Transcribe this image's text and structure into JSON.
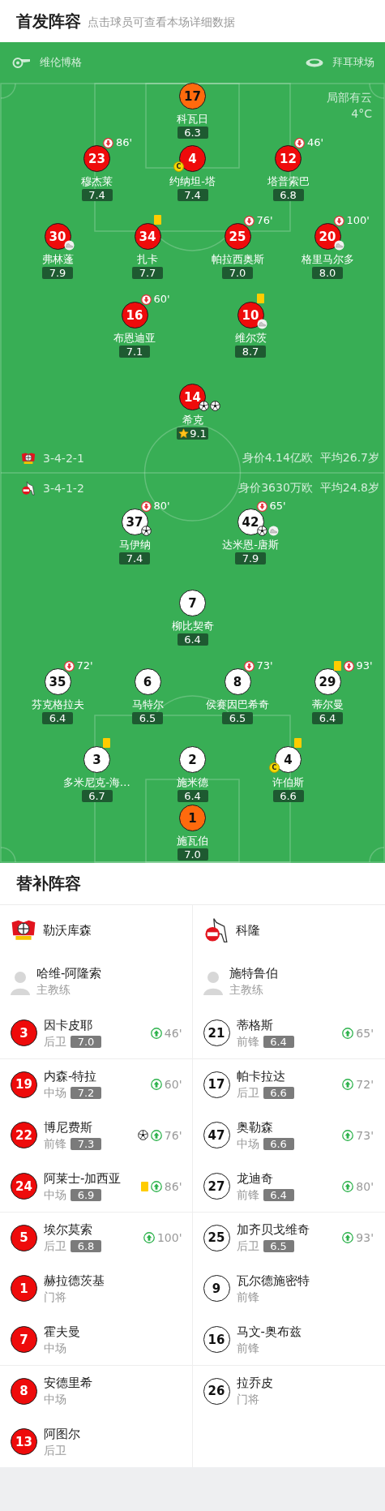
{
  "header": {
    "title": "首发阵容",
    "subtitle": "点击球员可查看本场详细数据"
  },
  "match_info": {
    "referee": "维伦博格",
    "stadium": "拜耳球场",
    "weather": "局部有云",
    "temperature": "4°C"
  },
  "lineups": [
    {
      "kind": "home",
      "formation": "3-4-2-1",
      "value": "身价4.14亿欧",
      "avg_age": "平均26.7岁",
      "rows": [
        [
          {
            "number": "17",
            "name": "科瓦日",
            "rating": "6.3",
            "goalkeeper": true,
            "best": false
          }
        ],
        [
          {
            "number": "23",
            "name": "穆杰莱",
            "rating": "7.4",
            "goalkeeper": false,
            "best": false,
            "events": [
              {
                "kind": "sub_out",
                "minute": "86'"
              }
            ]
          },
          {
            "number": "4",
            "name": "约纳坦-塔",
            "rating": "7.4",
            "goalkeeper": false,
            "best": false,
            "events": [
              {
                "kind": "captain",
                "label": "C"
              }
            ]
          },
          {
            "number": "12",
            "name": "塔普索巴",
            "rating": "6.8",
            "goalkeeper": false,
            "best": false,
            "events": [
              {
                "kind": "sub_out",
                "minute": "46'"
              }
            ]
          }
        ],
        [
          {
            "number": "30",
            "name": "弗林蓬",
            "rating": "7.9",
            "goalkeeper": false,
            "best": false,
            "events": [
              {
                "kind": "assist"
              }
            ]
          },
          {
            "number": "34",
            "name": "扎卡",
            "rating": "7.7",
            "goalkeeper": false,
            "best": false,
            "events": [
              {
                "kind": "yellow_card"
              }
            ]
          },
          {
            "number": "25",
            "name": "帕拉西奥斯",
            "rating": "7.0",
            "goalkeeper": false,
            "best": false,
            "events": [
              {
                "kind": "sub_out",
                "minute": "76'"
              }
            ]
          },
          {
            "number": "20",
            "name": "格里马尔多",
            "rating": "8.0",
            "goalkeeper": false,
            "best": false,
            "events": [
              {
                "kind": "sub_out",
                "minute": "100'"
              },
              {
                "kind": "assist"
              }
            ]
          }
        ],
        [
          {
            "number": "16",
            "name": "布恩迪亚",
            "rating": "7.1",
            "goalkeeper": false,
            "best": false,
            "events": [
              {
                "kind": "sub_out",
                "minute": "60'"
              }
            ]
          },
          {
            "number": "10",
            "name": "维尔茨",
            "rating": "8.7",
            "goalkeeper": false,
            "best": false,
            "events": [
              {
                "kind": "yellow_card"
              },
              {
                "kind": "assist"
              }
            ]
          }
        ],
        [
          {
            "number": "14",
            "name": "希克",
            "rating": "9.1",
            "goalkeeper": false,
            "best": true,
            "events": [
              {
                "kind": "goal"
              },
              {
                "kind": "goal"
              }
            ]
          }
        ]
      ]
    },
    {
      "kind": "away",
      "formation": "3-4-1-2",
      "value": "身价3630万欧",
      "avg_age": "平均24.8岁",
      "rows": [
        [
          {
            "number": "37",
            "name": "马伊纳",
            "rating": "7.4",
            "goalkeeper": false,
            "best": false,
            "events": [
              {
                "kind": "sub_out",
                "minute": "80'"
              },
              {
                "kind": "goal"
              }
            ]
          },
          {
            "number": "42",
            "name": "达米恩-唐斯",
            "rating": "7.9",
            "goalkeeper": false,
            "best": false,
            "events": [
              {
                "kind": "sub_out",
                "minute": "65'"
              },
              {
                "kind": "goal"
              },
              {
                "kind": "assist"
              }
            ]
          }
        ],
        [
          {
            "number": "7",
            "name": "柳比契奇",
            "rating": "6.4",
            "goalkeeper": false,
            "best": false
          }
        ],
        [
          {
            "number": "35",
            "name": "芬克格拉夫",
            "rating": "6.4",
            "goalkeeper": false,
            "best": false,
            "events": [
              {
                "kind": "sub_out",
                "minute": "72'"
              }
            ]
          },
          {
            "number": "6",
            "name": "马特尔",
            "rating": "6.5",
            "goalkeeper": false,
            "best": false
          },
          {
            "number": "8",
            "name": "侯赛因巴希奇",
            "rating": "6.5",
            "goalkeeper": false,
            "best": false,
            "events": [
              {
                "kind": "sub_out",
                "minute": "73'"
              }
            ]
          },
          {
            "number": "29",
            "name": "蒂尔曼",
            "rating": "6.4",
            "goalkeeper": false,
            "best": false,
            "events": [
              {
                "kind": "yellow_card"
              },
              {
                "kind": "sub_out",
                "minute": "93'"
              }
            ]
          }
        ],
        [
          {
            "number": "3",
            "name": "多米尼克-海…",
            "rating": "6.7",
            "goalkeeper": false,
            "best": false,
            "events": [
              {
                "kind": "yellow_card"
              }
            ]
          },
          {
            "number": "2",
            "name": "施米德",
            "rating": "6.4",
            "goalkeeper": false,
            "best": false
          },
          {
            "number": "4",
            "name": "许伯斯",
            "rating": "6.6",
            "goalkeeper": false,
            "best": false,
            "events": [
              {
                "kind": "yellow_card"
              },
              {
                "kind": "captain",
                "label": "C"
              }
            ]
          }
        ],
        [
          {
            "number": "1",
            "name": "施瓦伯",
            "rating": "7.0",
            "goalkeeper": true,
            "best": false
          }
        ]
      ]
    }
  ],
  "subs": {
    "title": "替补阵容",
    "teams": [
      {
        "kind": "home",
        "name": "勒沃库森",
        "coach": {
          "name": "哈维-阿隆索",
          "role": "主教练"
        },
        "players": [
          {
            "number": "3",
            "name": "因卡皮耶",
            "position": "后卫",
            "rating": "7.0",
            "events": [
              {
                "kind": "sub_in",
                "minute": "46'"
              }
            ]
          },
          {
            "number": "19",
            "name": "内森-特拉",
            "position": "中场",
            "rating": "7.2",
            "events": [
              {
                "kind": "sub_in",
                "minute": "60'"
              }
            ]
          },
          {
            "number": "22",
            "name": "博尼费斯",
            "position": "前锋",
            "rating": "7.3",
            "events": [
              {
                "kind": "goal"
              },
              {
                "kind": "sub_in",
                "minute": "76'"
              }
            ]
          },
          {
            "number": "24",
            "name": "阿莱士-加西亚",
            "position": "中场",
            "rating": "6.9",
            "events": [
              {
                "kind": "yellow_card"
              },
              {
                "kind": "sub_in",
                "minute": "86'"
              }
            ]
          },
          {
            "number": "5",
            "name": "埃尔莫索",
            "position": "后卫",
            "rating": "6.8",
            "events": [
              {
                "kind": "sub_in",
                "minute": "100'"
              }
            ]
          },
          {
            "number": "1",
            "name": "赫拉德茨基",
            "position": "门将"
          },
          {
            "number": "7",
            "name": "霍夫曼",
            "position": "中场"
          },
          {
            "number": "8",
            "name": "安德里希",
            "position": "中场"
          },
          {
            "number": "13",
            "name": "阿图尔",
            "position": "后卫"
          }
        ]
      },
      {
        "kind": "away",
        "name": "科隆",
        "coach": {
          "name": "施特鲁伯",
          "role": "主教练"
        },
        "players": [
          {
            "number": "21",
            "name": "蒂格斯",
            "position": "前锋",
            "rating": "6.4",
            "events": [
              {
                "kind": "sub_in",
                "minute": "65'"
              }
            ]
          },
          {
            "number": "17",
            "name": "帕卡拉达",
            "position": "后卫",
            "rating": "6.6",
            "events": [
              {
                "kind": "sub_in",
                "minute": "72'"
              }
            ]
          },
          {
            "number": "47",
            "name": "奥勒森",
            "position": "中场",
            "rating": "6.6",
            "events": [
              {
                "kind": "sub_in",
                "minute": "73'"
              }
            ]
          },
          {
            "number": "27",
            "name": "龙迪奇",
            "position": "前锋",
            "rating": "6.4",
            "events": [
              {
                "kind": "sub_in",
                "minute": "80'"
              }
            ]
          },
          {
            "number": "25",
            "name": "加齐贝戈维奇",
            "position": "后卫",
            "rating": "6.5",
            "events": [
              {
                "kind": "sub_in",
                "minute": "93'"
              }
            ]
          },
          {
            "number": "9",
            "name": "瓦尔德施密特",
            "position": "前锋"
          },
          {
            "number": "16",
            "name": "马文-奥布兹",
            "position": "前锋"
          },
          {
            "number": "26",
            "name": "拉乔皮",
            "position": "门将"
          }
        ]
      }
    ]
  }
}
